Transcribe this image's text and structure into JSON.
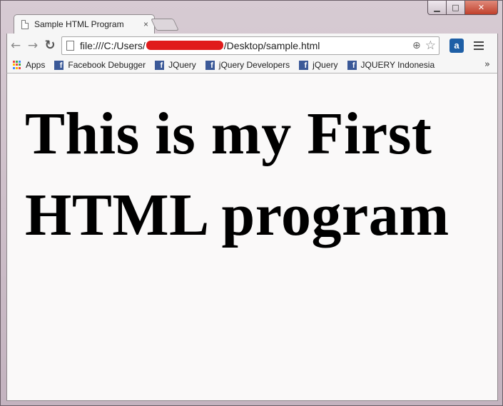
{
  "tab": {
    "title": "Sample HTML Program",
    "close": "×"
  },
  "window": {
    "minimize": "▁",
    "maximize": "□",
    "close": "✕"
  },
  "toolbar": {
    "back": "←",
    "forward": "→",
    "reload": "↻",
    "url_prefix": "file:///C:/Users/",
    "url_suffix": "/Desktop/sample.html",
    "extension_label": "a"
  },
  "bookmarks": {
    "apps": "Apps",
    "items": [
      "Facebook Debugger",
      "JQuery",
      "jQuery Developers",
      "jQuery",
      "JQUERY Indonesia"
    ],
    "overflow": "»"
  },
  "page": {
    "heading": "This is my First HTML program"
  },
  "colors": {
    "redaction": "#e01b1b",
    "facebook": "#3b5998"
  }
}
